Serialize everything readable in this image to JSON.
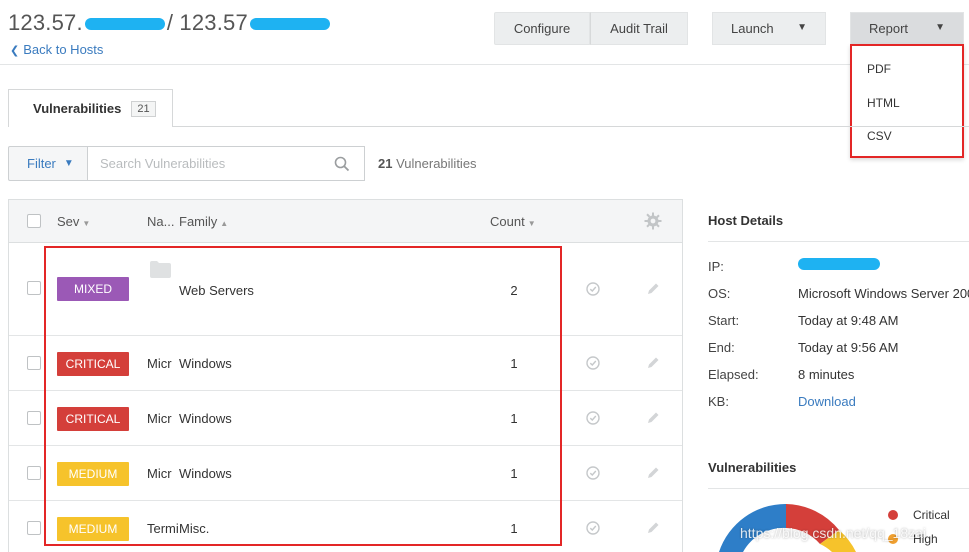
{
  "header": {
    "title_left": "123.57.",
    "title_sep": "/ 123.57",
    "back_label": "Back to Hosts"
  },
  "toolbar": {
    "configure": "Configure",
    "audit_trail": "Audit Trail",
    "launch": "Launch",
    "report": "Report"
  },
  "report_menu": [
    "PDF",
    "HTML",
    "CSV"
  ],
  "tabs": [
    {
      "label": "Vulnerabilities",
      "badge": "21"
    }
  ],
  "filter": {
    "label": "Filter",
    "search_placeholder": "Search Vulnerabilities",
    "count_num": "21",
    "count_label": "Vulnerabilities"
  },
  "table": {
    "headers": {
      "sev": "Sev",
      "name": "Na...",
      "family": "Family",
      "count": "Count"
    },
    "rows": [
      {
        "sev": "MIXED",
        "sev_color": "#9b59b6",
        "name": "",
        "family": "Web Servers",
        "count": "2"
      },
      {
        "sev": "CRITICAL",
        "sev_color": "#d43f3a",
        "name": "Micr",
        "family": "Windows",
        "count": "1"
      },
      {
        "sev": "CRITICAL",
        "sev_color": "#d43f3a",
        "name": "Micr",
        "family": "Windows",
        "count": "1"
      },
      {
        "sev": "MEDIUM",
        "sev_color": "#f6c32b",
        "name": "Micr",
        "family": "Windows",
        "count": "1"
      },
      {
        "sev": "MEDIUM",
        "sev_color": "#f6c32b",
        "name": "Termi",
        "family": "Misc.",
        "count": "1"
      }
    ]
  },
  "host_details": {
    "title": "Host Details",
    "rows": [
      {
        "label": "IP:",
        "value": ""
      },
      {
        "label": "OS:",
        "value": "Microsoft Windows Server 200"
      },
      {
        "label": "Start:",
        "value": "Today at 9:48 AM"
      },
      {
        "label": "End:",
        "value": "Today at 9:56 AM"
      },
      {
        "label": "Elapsed:",
        "value": "8 minutes"
      },
      {
        "label": "KB:",
        "value": "Download"
      }
    ]
  },
  "vulnerabilities_panel": {
    "title": "Vulnerabilities",
    "legend": [
      {
        "label": "Critical",
        "color": "#d43f3a"
      },
      {
        "label": "High",
        "color": "#f0a030"
      }
    ],
    "watermark": "https://blog.csdn.net/qq_18zai"
  }
}
